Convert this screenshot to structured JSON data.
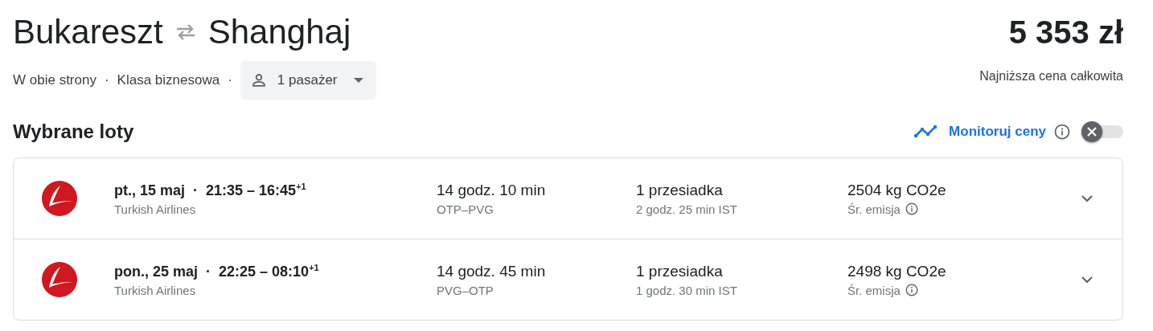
{
  "route": {
    "origin": "Bukareszt",
    "destination": "Shanghaj"
  },
  "trip_options": {
    "trip_type": "W obie strony",
    "separator": "·",
    "cabin_class": "Klasa biznesowa",
    "passengers": "1 pasażer"
  },
  "price": {
    "amount": "5 353 zł",
    "caption": "Najniższa cena całkowita"
  },
  "section_title": "Wybrane loty",
  "price_tracking": {
    "label": "Monitoruj ceny",
    "on": false
  },
  "flights": [
    {
      "schedule": "pt., 15 maj  ·  21:35 – 16:45$^{+1}$",
      "airline": "Turkish Airlines",
      "duration": "14 godz. 10 min",
      "route": "OTP–PVG",
      "stops": "1 przesiadka",
      "layover": "2 godz. 25 min IST",
      "emissions": "2504 kg CO2e",
      "emissions_label": "Śr. emisja",
      "expanded": false
    },
    {
      "schedule": "pon., 25 maj  ·  22:25 – 08:10$^{+1}$",
      "airline": "Turkish Airlines",
      "duration": "14 godz. 45 min",
      "route": "PVG–OTP",
      "stops": "1 przesiadka",
      "layover": "1 godz. 30 min IST",
      "emissions": "2498 kg CO2e",
      "emissions_label": "Śr. emisja",
      "expanded": false
    }
  ]
}
